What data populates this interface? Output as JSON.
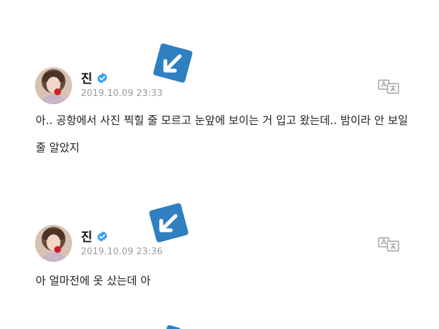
{
  "posts": [
    {
      "author": "진",
      "timestamp": "2019.10.09 23:33",
      "body": "아.. 공항에서 사진 찍힐 줄 모르고 눈앞에 보이는 거 입고 왔는데.. 밤이라 안 보일 줄 알았지",
      "translate_icon": "translate-icon",
      "verified_icon": "verified-badge-icon",
      "avatar": "avatar"
    },
    {
      "author": "진",
      "timestamp": "2019.10.09 23:36",
      "body": "아 얼마전에 옷 샀는데 아",
      "translate_icon": "translate-icon",
      "verified_icon": "verified-badge-icon",
      "avatar": "avatar"
    }
  ],
  "overlay": {
    "arrow_icon": "arrow-down-left-icon",
    "arrow_color": "#2f7fc1"
  },
  "colors": {
    "verified": "#3aa0f3",
    "timestamp": "#9a9a9a",
    "text": "#222222"
  }
}
